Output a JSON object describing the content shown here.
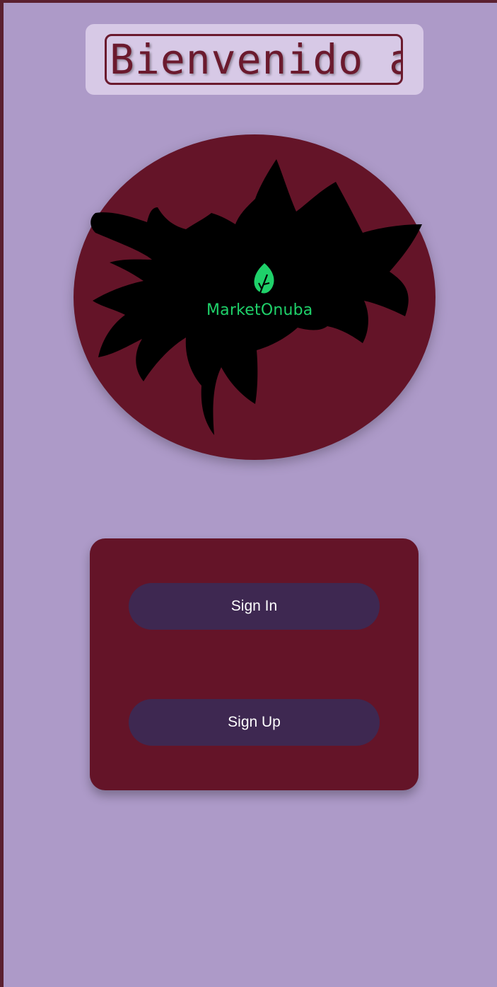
{
  "header": {
    "title": "Bienvenido a"
  },
  "logo": {
    "brand_name": "MarketOnuba",
    "icon": "leaf-icon",
    "circle_color": "#641428",
    "splash_color": "#000000",
    "brand_color": "#1fd16a"
  },
  "auth": {
    "sign_in_label": "Sign In",
    "sign_up_label": "Sign Up",
    "card_color": "#641428",
    "button_color": "#3e2851"
  },
  "theme": {
    "background": "#ad9ac8",
    "title_card": "#d7c9e6",
    "title_text": "#6b1a2e"
  }
}
